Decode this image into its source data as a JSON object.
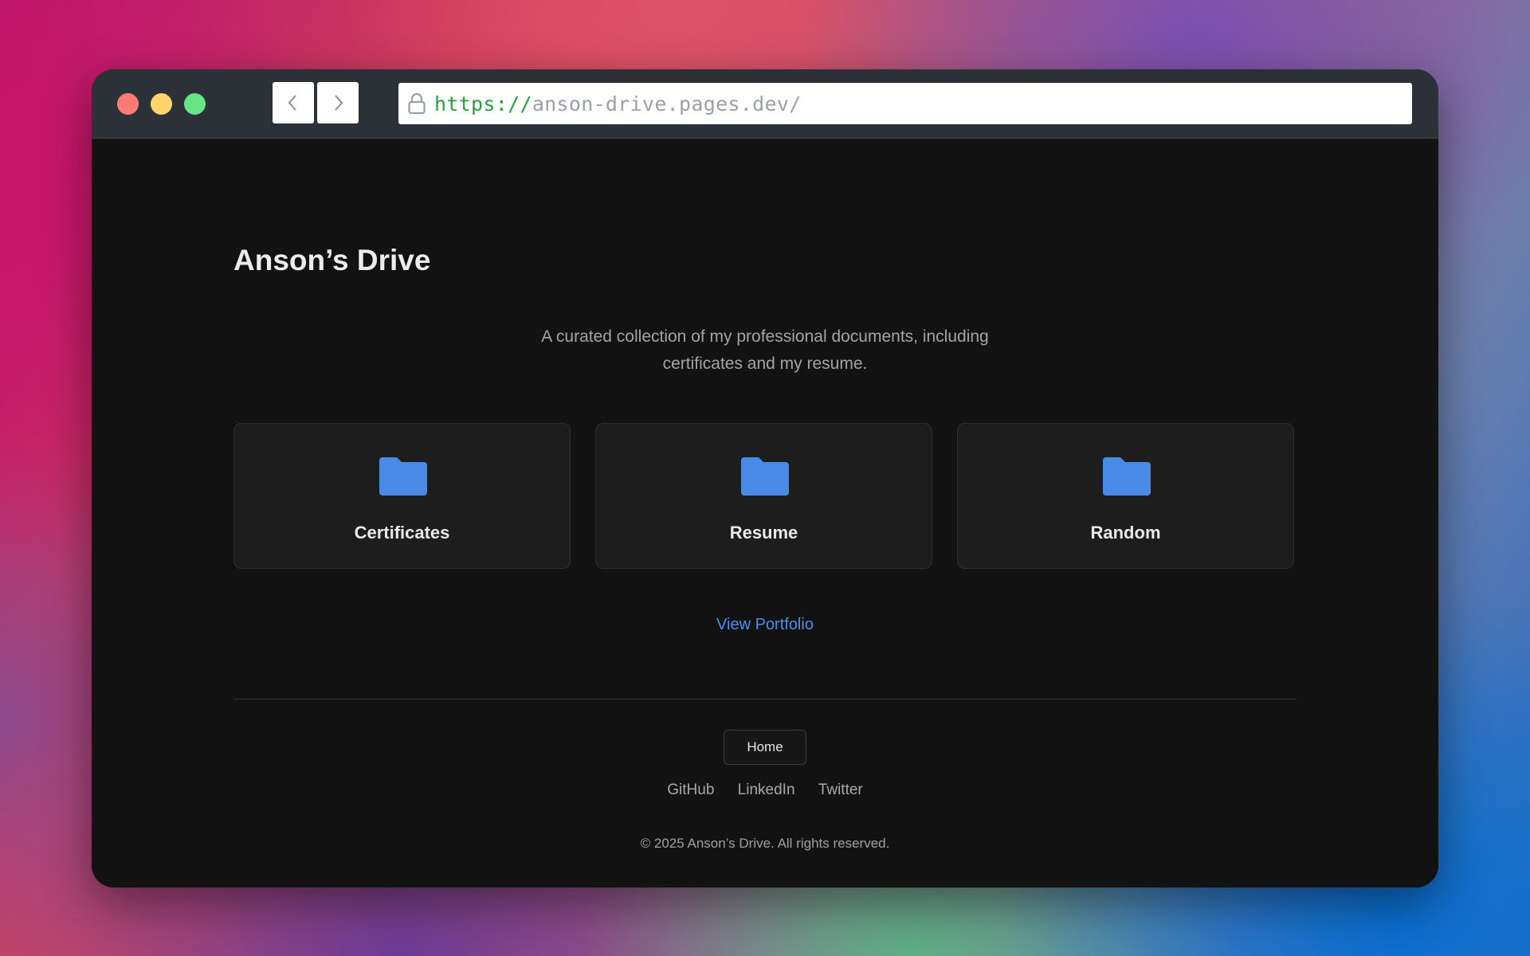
{
  "browser": {
    "url_scheme": "https://",
    "url_host": "anson-drive.pages.dev/"
  },
  "page": {
    "title": "Anson’s Drive",
    "description_line1": "A curated collection of my professional documents, including",
    "description_line2": "certificates and my resume."
  },
  "folders": [
    {
      "label": "Certificates",
      "icon": "folder-icon"
    },
    {
      "label": "Resume",
      "icon": "folder-icon"
    },
    {
      "label": "Random",
      "icon": "folder-icon"
    }
  ],
  "portfolio_link": "View Portfolio",
  "footer": {
    "home_button": "Home",
    "social": [
      "GitHub",
      "LinkedIn",
      "Twitter"
    ],
    "copyright": "© 2025 Anson’s Drive. All rights reserved."
  },
  "colors": {
    "accent": "#4a8df0",
    "folder": "#4a8be8",
    "background": "#121212",
    "card": "#1d1d1d"
  }
}
